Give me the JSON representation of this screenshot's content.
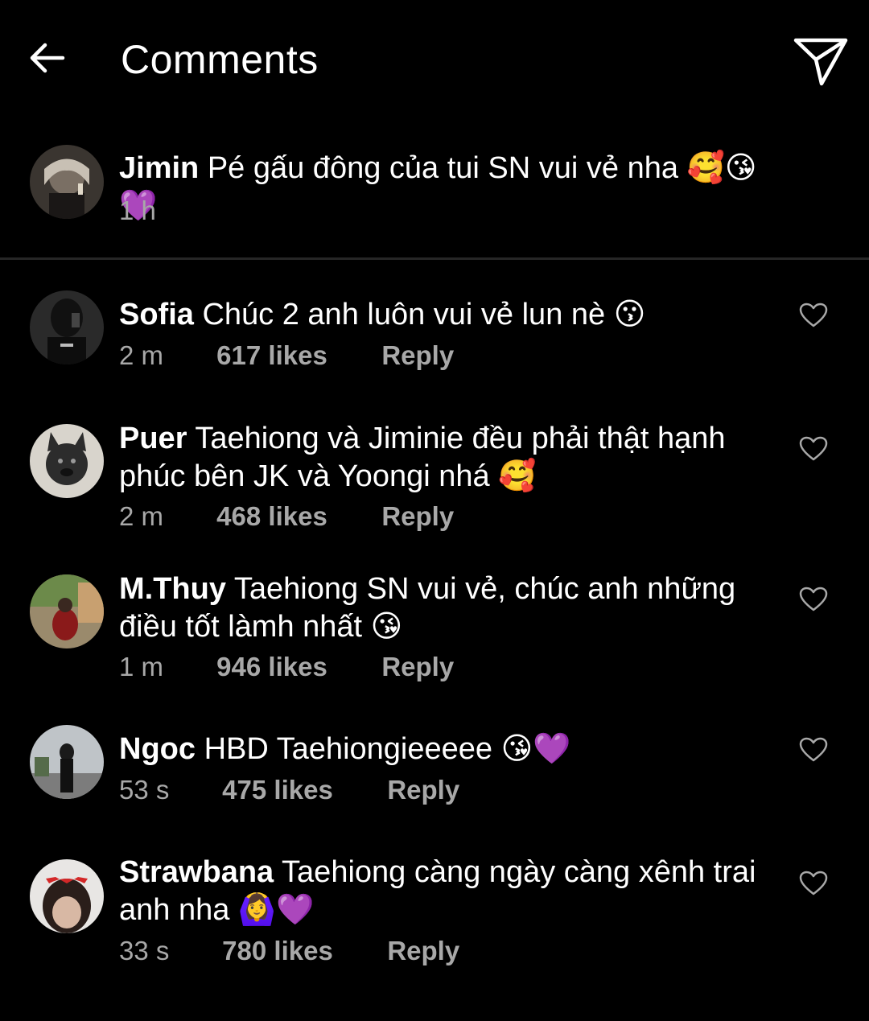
{
  "header": {
    "title": "Comments"
  },
  "caption": {
    "username": "Jimin",
    "text": "Pé gấu đông của tui SN vui vẻ nha 🥰😘💜",
    "time": "1 h"
  },
  "comments": [
    {
      "username": "Sofia",
      "text": "Chúc 2 anh luôn vui vẻ lun nè 😗",
      "time": "2 m",
      "likes": "617 likes",
      "reply": "Reply"
    },
    {
      "username": "Puer",
      "text": "Taehiong và Jiminie đều phải thật hạnh phúc bên JK và Yoongi nhá 🥰",
      "time": "2 m",
      "likes": "468 likes",
      "reply": "Reply"
    },
    {
      "username": "M.Thuy",
      "text": "Taehiong SN vui vẻ, chúc anh những điều tốt làmh nhất 😘",
      "time": "1 m",
      "likes": "946 likes",
      "reply": "Reply"
    },
    {
      "username": "Ngoc",
      "text": "HBD Taehiongieeeee 😘💜",
      "time": "53 s",
      "likes": "475 likes",
      "reply": "Reply"
    },
    {
      "username": "Strawbana",
      "text": "Taehiong càng ngày càng xênh trai anh nha 🙆‍♀️💜",
      "time": "33 s",
      "likes": "780 likes",
      "reply": "Reply"
    }
  ],
  "icons": {
    "back": "arrow-left-icon",
    "share": "paper-plane-icon",
    "like": "heart-outline-icon"
  },
  "colors": {
    "background": "#000000",
    "text": "#ffffff",
    "secondary_text": "#a8a8a8",
    "divider": "#262626"
  }
}
